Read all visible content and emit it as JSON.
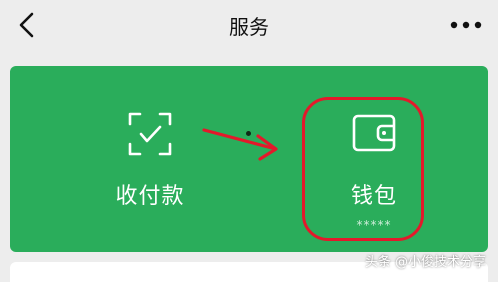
{
  "header": {
    "title": "服务"
  },
  "services": [
    {
      "label": "收付款",
      "icon": "scan-check-icon"
    },
    {
      "label": "钱包",
      "icon": "wallet-icon",
      "masked_balance": "*****"
    }
  ],
  "annotation": {
    "color": "#e3192b"
  },
  "watermark": "头条 @小俊技术分享",
  "colors": {
    "accent_green": "#2aad5b",
    "background": "#ededed"
  }
}
